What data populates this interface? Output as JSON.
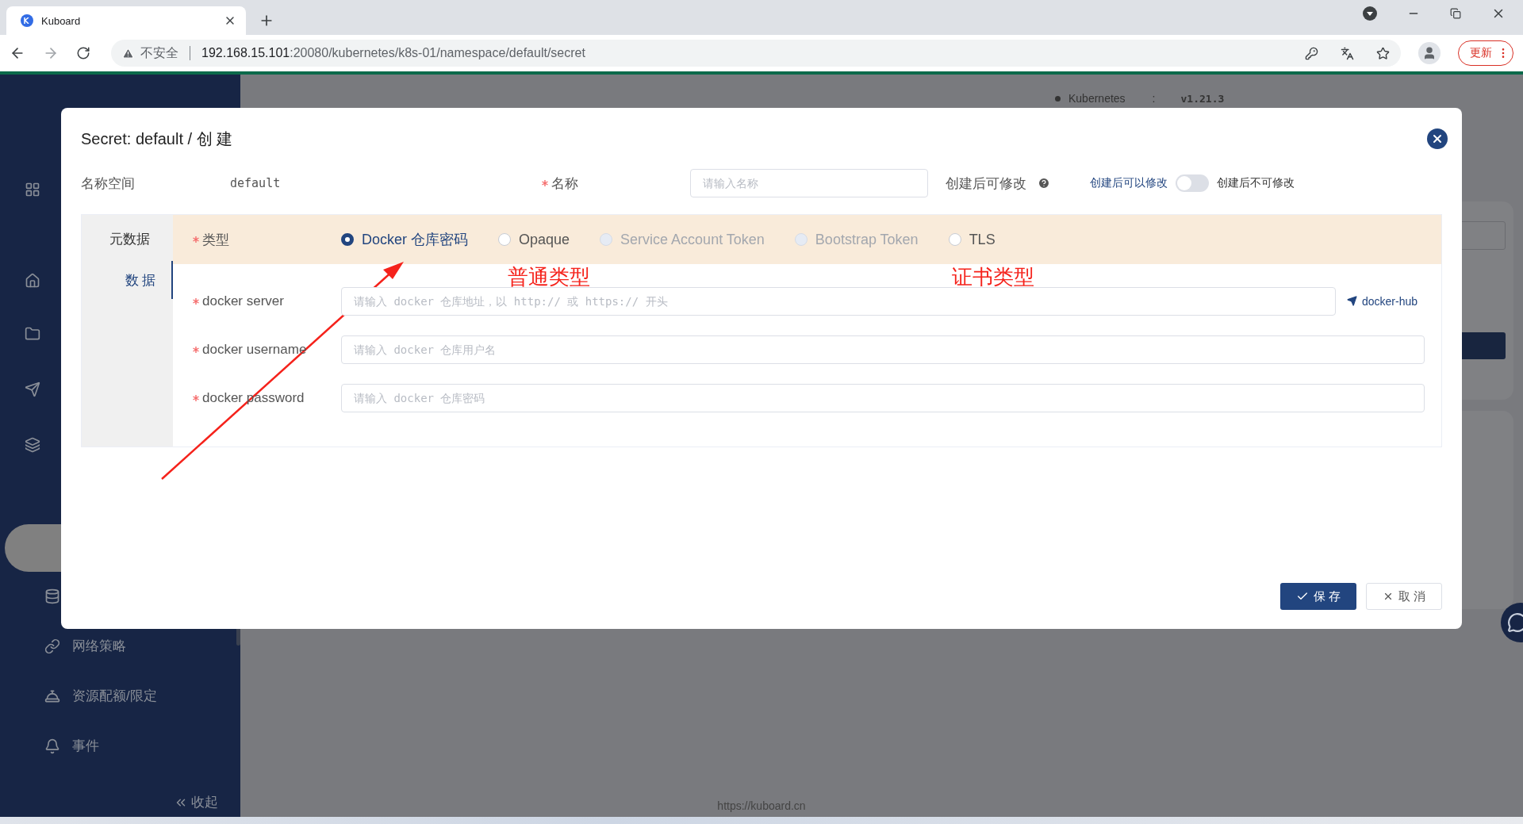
{
  "browser": {
    "tab": {
      "title": "Kuboard"
    },
    "address": {
      "security": "不安全",
      "host": "192.168.15.101",
      "path": ":20080/kubernetes/k8s-01/namespace/default/secret"
    },
    "update_button": "更新"
  },
  "header": {
    "cluster_label": "Kubernetes",
    "separator": ":",
    "version": "v1.21.3"
  },
  "sidebar": {
    "items": [
      {
        "label": "网络策略"
      },
      {
        "label": "资源配额/限定"
      },
      {
        "label": "事件"
      }
    ],
    "collapse": "收起"
  },
  "footer": "https://kuboard.cn",
  "dialog": {
    "title": "Secret: default / 创 建",
    "namespace_label": "名称空间",
    "namespace_value": "default",
    "name_field": {
      "label": "名称",
      "required": true,
      "placeholder": "请输入名称"
    },
    "editable": {
      "label": "创建后可修改",
      "on_label": "创建后不可修改",
      "off_label": "创建后可以修改",
      "on": false
    },
    "tabs": [
      {
        "label": "元数据",
        "selected": false
      },
      {
        "label": "数 据",
        "selected": true
      }
    ],
    "type": {
      "label": "类型",
      "required": true,
      "options": [
        {
          "label": "Docker 仓库密码",
          "selected": true,
          "disabled": false
        },
        {
          "label": "Opaque",
          "selected": false,
          "disabled": false
        },
        {
          "label": "Service Account Token",
          "selected": false,
          "disabled": true
        },
        {
          "label": "Bootstrap Token",
          "selected": false,
          "disabled": true
        },
        {
          "label": "TLS",
          "selected": false,
          "disabled": false
        }
      ]
    },
    "fields": [
      {
        "label": "docker server",
        "required": true,
        "placeholder": "请输入 docker 仓库地址，以 http:// 或 https:// 开头",
        "link": "docker-hub"
      },
      {
        "label": "docker username",
        "required": true,
        "placeholder": "请输入 docker 仓库用户名"
      },
      {
        "label": "docker password",
        "required": true,
        "placeholder": "请输入 docker 仓库密码"
      }
    ],
    "buttons": {
      "save": "保 存",
      "cancel": "取 消"
    },
    "annotations": [
      {
        "text": "普通类型"
      },
      {
        "text": "证书类型"
      }
    ]
  }
}
